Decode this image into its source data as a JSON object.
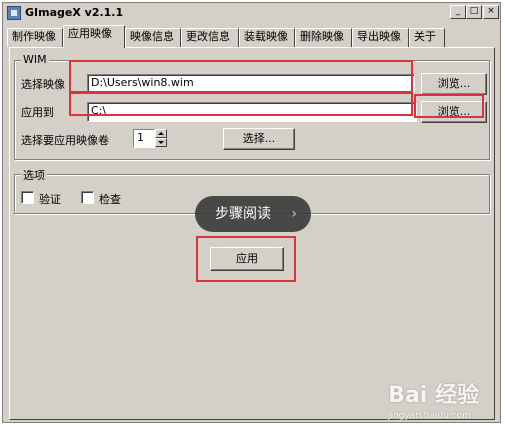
{
  "window": {
    "title": "GImageX v2.1.1",
    "controls": {
      "minimize": "_",
      "maximize": "□",
      "close": "×"
    }
  },
  "tabs": [
    {
      "label": "制作映像",
      "active": false
    },
    {
      "label": "应用映像",
      "active": true
    },
    {
      "label": "映像信息",
      "active": false
    },
    {
      "label": "更改信息",
      "active": false
    },
    {
      "label": "装载映像",
      "active": false
    },
    {
      "label": "删除映像",
      "active": false
    },
    {
      "label": "导出映像",
      "active": false
    },
    {
      "label": "关于",
      "active": false
    }
  ],
  "wim_group": {
    "title": "WIM",
    "select_image_label": "选择映像",
    "select_image_value": "D:\\Users\\win8.wim",
    "browse_label_1": "浏览...",
    "apply_to_label": "应用到",
    "apply_to_value": "C:\\",
    "browse_label_2": "浏览...",
    "volume_label": "选择要应用映像卷",
    "volume_value": "1",
    "select_button_label": "选择..."
  },
  "options_group": {
    "title": "选项",
    "verify_label": "验证",
    "verify_checked": false,
    "check_label": "检查",
    "check_checked": false
  },
  "apply_button_label": "应用",
  "overlay": {
    "text": "步骤阅读",
    "chevron": "›"
  },
  "watermark": {
    "brand": "Bai 经验",
    "url": "jingyan.baidu.com"
  },
  "colors": {
    "highlight": "#d9333f",
    "window_bg": "#d4d0c8"
  }
}
